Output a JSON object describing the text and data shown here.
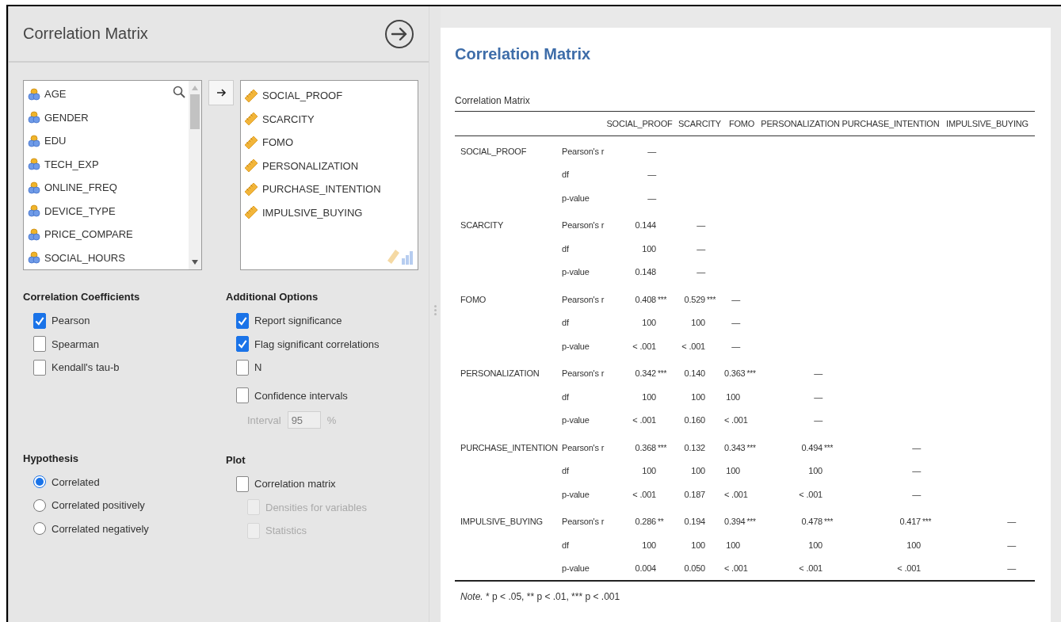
{
  "options_panel": {
    "title": "Correlation Matrix",
    "available_variables": [
      "AGE",
      "GENDER",
      "EDU",
      "TECH_EXP",
      "ONLINE_FREQ",
      "DEVICE_TYPE",
      "PRICE_COMPARE",
      "SOCIAL_HOURS"
    ],
    "selected_variables": [
      "SOCIAL_PROOF",
      "SCARCITY",
      "FOMO",
      "PERSONALIZATION",
      "PURCHASE_INTENTION",
      "IMPULSIVE_BUYING"
    ],
    "correlation_coefficients": {
      "heading": "Correlation Coefficients",
      "options": [
        {
          "label": "Pearson",
          "checked": true,
          "disabled": false
        },
        {
          "label": "Spearman",
          "checked": false,
          "disabled": false
        },
        {
          "label": "Kendall's tau-b",
          "checked": false,
          "disabled": false
        }
      ]
    },
    "additional_options": {
      "heading": "Additional Options",
      "options": [
        {
          "label": "Report significance",
          "checked": true,
          "disabled": false
        },
        {
          "label": "Flag significant correlations",
          "checked": true,
          "disabled": false
        },
        {
          "label": "N",
          "checked": false,
          "disabled": false
        },
        {
          "label": "Confidence intervals",
          "checked": false,
          "disabled": false
        }
      ],
      "interval": {
        "label": "Interval",
        "value": "95",
        "unit": "%",
        "disabled": true
      }
    },
    "hypothesis": {
      "heading": "Hypothesis",
      "options": [
        {
          "label": "Correlated",
          "selected": true
        },
        {
          "label": "Correlated positively",
          "selected": false
        },
        {
          "label": "Correlated negatively",
          "selected": false
        }
      ]
    },
    "plot": {
      "heading": "Plot",
      "options": [
        {
          "label": "Correlation matrix",
          "checked": false,
          "disabled": false,
          "children": [
            {
              "label": "Densities for variables",
              "checked": false,
              "disabled": true
            },
            {
              "label": "Statistics",
              "checked": false,
              "disabled": true
            }
          ]
        }
      ]
    }
  },
  "results": {
    "title": "Correlation Matrix",
    "table": {
      "caption": "Correlation Matrix",
      "columns": [
        "SOCIAL_PROOF",
        "SCARCITY",
        "FOMO",
        "PERSONALIZATION",
        "PURCHASE_INTENTION",
        "IMPULSIVE_BUYING"
      ],
      "rows": [
        {
          "variable": "SOCIAL_PROOF",
          "stats": [
            {
              "label": "Pearson's r",
              "cells": [
                {
                  "value": "—"
                }
              ]
            },
            {
              "label": "df",
              "cells": [
                {
                  "value": "—"
                }
              ]
            },
            {
              "label": "p-value",
              "cells": [
                {
                  "value": "—"
                }
              ]
            }
          ]
        },
        {
          "variable": "SCARCITY",
          "stats": [
            {
              "label": "Pearson's r",
              "cells": [
                {
                  "value": "0.144"
                },
                {
                  "value": "—"
                }
              ]
            },
            {
              "label": "df",
              "cells": [
                {
                  "value": "100"
                },
                {
                  "value": "—"
                }
              ]
            },
            {
              "label": "p-value",
              "cells": [
                {
                  "value": "0.148"
                },
                {
                  "value": "—"
                }
              ]
            }
          ]
        },
        {
          "variable": "FOMO",
          "stats": [
            {
              "label": "Pearson's r",
              "cells": [
                {
                  "value": "0.408",
                  "flag": "***"
                },
                {
                  "value": "0.529",
                  "flag": "***"
                },
                {
                  "value": "—"
                }
              ]
            },
            {
              "label": "df",
              "cells": [
                {
                  "value": "100"
                },
                {
                  "value": "100"
                },
                {
                  "value": "—"
                }
              ]
            },
            {
              "label": "p-value",
              "cells": [
                {
                  "value": "< .001"
                },
                {
                  "value": "< .001"
                },
                {
                  "value": "—"
                }
              ]
            }
          ]
        },
        {
          "variable": "PERSONALIZATION",
          "stats": [
            {
              "label": "Pearson's r",
              "cells": [
                {
                  "value": "0.342",
                  "flag": "***"
                },
                {
                  "value": "0.140"
                },
                {
                  "value": "0.363",
                  "flag": "***"
                },
                {
                  "value": "—"
                }
              ]
            },
            {
              "label": "df",
              "cells": [
                {
                  "value": "100"
                },
                {
                  "value": "100"
                },
                {
                  "value": "100"
                },
                {
                  "value": "—"
                }
              ]
            },
            {
              "label": "p-value",
              "cells": [
                {
                  "value": "< .001"
                },
                {
                  "value": "0.160"
                },
                {
                  "value": "< .001"
                },
                {
                  "value": "—"
                }
              ]
            }
          ]
        },
        {
          "variable": "PURCHASE_INTENTION",
          "stats": [
            {
              "label": "Pearson's r",
              "cells": [
                {
                  "value": "0.368",
                  "flag": "***"
                },
                {
                  "value": "0.132"
                },
                {
                  "value": "0.343",
                  "flag": "***"
                },
                {
                  "value": "0.494",
                  "flag": "***"
                },
                {
                  "value": "—"
                }
              ]
            },
            {
              "label": "df",
              "cells": [
                {
                  "value": "100"
                },
                {
                  "value": "100"
                },
                {
                  "value": "100"
                },
                {
                  "value": "100"
                },
                {
                  "value": "—"
                }
              ]
            },
            {
              "label": "p-value",
              "cells": [
                {
                  "value": "< .001"
                },
                {
                  "value": "0.187"
                },
                {
                  "value": "< .001"
                },
                {
                  "value": "< .001"
                },
                {
                  "value": "—"
                }
              ]
            }
          ]
        },
        {
          "variable": "IMPULSIVE_BUYING",
          "stats": [
            {
              "label": "Pearson's r",
              "cells": [
                {
                  "value": "0.286",
                  "flag": "**"
                },
                {
                  "value": "0.194"
                },
                {
                  "value": "0.394",
                  "flag": "***"
                },
                {
                  "value": "0.478",
                  "flag": "***"
                },
                {
                  "value": "0.417",
                  "flag": "***"
                },
                {
                  "value": "—"
                }
              ]
            },
            {
              "label": "df",
              "cells": [
                {
                  "value": "100"
                },
                {
                  "value": "100"
                },
                {
                  "value": "100"
                },
                {
                  "value": "100"
                },
                {
                  "value": "100"
                },
                {
                  "value": "—"
                }
              ]
            },
            {
              "label": "p-value",
              "cells": [
                {
                  "value": "0.004"
                },
                {
                  "value": "0.050"
                },
                {
                  "value": "< .001"
                },
                {
                  "value": "< .001"
                },
                {
                  "value": "< .001"
                },
                {
                  "value": "—"
                }
              ]
            }
          ]
        }
      ],
      "note": {
        "label": "Note.",
        "text": "* p < .05, ** p < .01, *** p < .001"
      }
    }
  }
}
